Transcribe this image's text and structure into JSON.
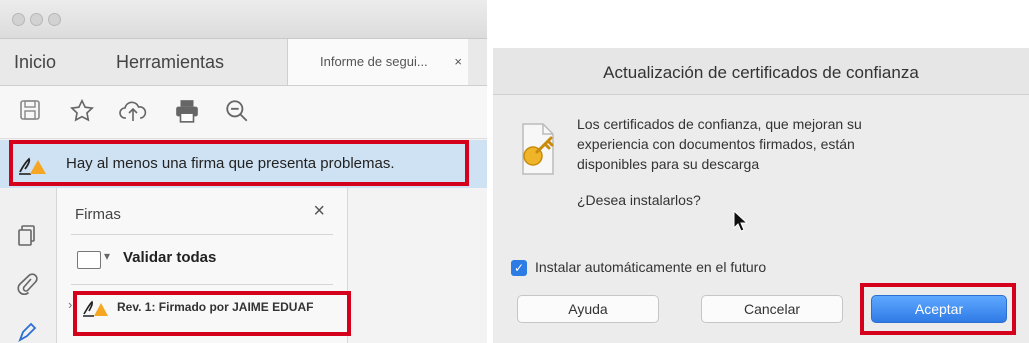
{
  "acrobat": {
    "tabs": {
      "home": "Inicio",
      "tools": "Herramientas",
      "document": "Informe de segui...",
      "close_glyph": "×"
    },
    "warning": {
      "message": "Hay al menos una firma que presenta problemas."
    },
    "signatures_panel": {
      "title": "Firmas",
      "close_glyph": "×",
      "validate_all": "Validar todas",
      "caret": "▾",
      "revision_item": "Rev. 1: Firmado por JAIME EDUAF"
    }
  },
  "dialog": {
    "title": "Actualización de certificados de confianza",
    "message": "Los certificados de confianza, que mejoran su\nexperiencia con documentos firmados, están\ndisponibles para su descarga",
    "question": "¿Desea instalarlos?",
    "checkbox": {
      "label": "Instalar automáticamente en el futuro",
      "checked": true,
      "glyph": "✓"
    },
    "buttons": {
      "help": "Ayuda",
      "cancel": "Cancelar",
      "accept": "Aceptar"
    }
  },
  "colors": {
    "highlight": "#d5001c",
    "accent": "#2f7be6",
    "banner": "#cfe2f3"
  }
}
